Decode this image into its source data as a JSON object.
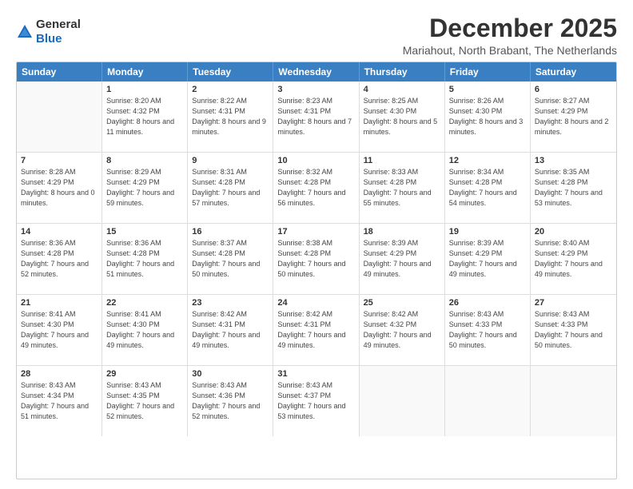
{
  "logo": {
    "general": "General",
    "blue": "Blue"
  },
  "header": {
    "month_year": "December 2025",
    "location": "Mariahout, North Brabant, The Netherlands"
  },
  "days_of_week": [
    "Sunday",
    "Monday",
    "Tuesday",
    "Wednesday",
    "Thursday",
    "Friday",
    "Saturday"
  ],
  "weeks": [
    [
      {
        "day": "",
        "empty": true
      },
      {
        "day": "1",
        "sunrise": "Sunrise: 8:20 AM",
        "sunset": "Sunset: 4:32 PM",
        "daylight": "Daylight: 8 hours and 11 minutes."
      },
      {
        "day": "2",
        "sunrise": "Sunrise: 8:22 AM",
        "sunset": "Sunset: 4:31 PM",
        "daylight": "Daylight: 8 hours and 9 minutes."
      },
      {
        "day": "3",
        "sunrise": "Sunrise: 8:23 AM",
        "sunset": "Sunset: 4:31 PM",
        "daylight": "Daylight: 8 hours and 7 minutes."
      },
      {
        "day": "4",
        "sunrise": "Sunrise: 8:25 AM",
        "sunset": "Sunset: 4:30 PM",
        "daylight": "Daylight: 8 hours and 5 minutes."
      },
      {
        "day": "5",
        "sunrise": "Sunrise: 8:26 AM",
        "sunset": "Sunset: 4:30 PM",
        "daylight": "Daylight: 8 hours and 3 minutes."
      },
      {
        "day": "6",
        "sunrise": "Sunrise: 8:27 AM",
        "sunset": "Sunset: 4:29 PM",
        "daylight": "Daylight: 8 hours and 2 minutes."
      }
    ],
    [
      {
        "day": "7",
        "sunrise": "Sunrise: 8:28 AM",
        "sunset": "Sunset: 4:29 PM",
        "daylight": "Daylight: 8 hours and 0 minutes."
      },
      {
        "day": "8",
        "sunrise": "Sunrise: 8:29 AM",
        "sunset": "Sunset: 4:29 PM",
        "daylight": "Daylight: 7 hours and 59 minutes."
      },
      {
        "day": "9",
        "sunrise": "Sunrise: 8:31 AM",
        "sunset": "Sunset: 4:28 PM",
        "daylight": "Daylight: 7 hours and 57 minutes."
      },
      {
        "day": "10",
        "sunrise": "Sunrise: 8:32 AM",
        "sunset": "Sunset: 4:28 PM",
        "daylight": "Daylight: 7 hours and 56 minutes."
      },
      {
        "day": "11",
        "sunrise": "Sunrise: 8:33 AM",
        "sunset": "Sunset: 4:28 PM",
        "daylight": "Daylight: 7 hours and 55 minutes."
      },
      {
        "day": "12",
        "sunrise": "Sunrise: 8:34 AM",
        "sunset": "Sunset: 4:28 PM",
        "daylight": "Daylight: 7 hours and 54 minutes."
      },
      {
        "day": "13",
        "sunrise": "Sunrise: 8:35 AM",
        "sunset": "Sunset: 4:28 PM",
        "daylight": "Daylight: 7 hours and 53 minutes."
      }
    ],
    [
      {
        "day": "14",
        "sunrise": "Sunrise: 8:36 AM",
        "sunset": "Sunset: 4:28 PM",
        "daylight": "Daylight: 7 hours and 52 minutes."
      },
      {
        "day": "15",
        "sunrise": "Sunrise: 8:36 AM",
        "sunset": "Sunset: 4:28 PM",
        "daylight": "Daylight: 7 hours and 51 minutes."
      },
      {
        "day": "16",
        "sunrise": "Sunrise: 8:37 AM",
        "sunset": "Sunset: 4:28 PM",
        "daylight": "Daylight: 7 hours and 50 minutes."
      },
      {
        "day": "17",
        "sunrise": "Sunrise: 8:38 AM",
        "sunset": "Sunset: 4:28 PM",
        "daylight": "Daylight: 7 hours and 50 minutes."
      },
      {
        "day": "18",
        "sunrise": "Sunrise: 8:39 AM",
        "sunset": "Sunset: 4:29 PM",
        "daylight": "Daylight: 7 hours and 49 minutes."
      },
      {
        "day": "19",
        "sunrise": "Sunrise: 8:39 AM",
        "sunset": "Sunset: 4:29 PM",
        "daylight": "Daylight: 7 hours and 49 minutes."
      },
      {
        "day": "20",
        "sunrise": "Sunrise: 8:40 AM",
        "sunset": "Sunset: 4:29 PM",
        "daylight": "Daylight: 7 hours and 49 minutes."
      }
    ],
    [
      {
        "day": "21",
        "sunrise": "Sunrise: 8:41 AM",
        "sunset": "Sunset: 4:30 PM",
        "daylight": "Daylight: 7 hours and 49 minutes."
      },
      {
        "day": "22",
        "sunrise": "Sunrise: 8:41 AM",
        "sunset": "Sunset: 4:30 PM",
        "daylight": "Daylight: 7 hours and 49 minutes."
      },
      {
        "day": "23",
        "sunrise": "Sunrise: 8:42 AM",
        "sunset": "Sunset: 4:31 PM",
        "daylight": "Daylight: 7 hours and 49 minutes."
      },
      {
        "day": "24",
        "sunrise": "Sunrise: 8:42 AM",
        "sunset": "Sunset: 4:31 PM",
        "daylight": "Daylight: 7 hours and 49 minutes."
      },
      {
        "day": "25",
        "sunrise": "Sunrise: 8:42 AM",
        "sunset": "Sunset: 4:32 PM",
        "daylight": "Daylight: 7 hours and 49 minutes."
      },
      {
        "day": "26",
        "sunrise": "Sunrise: 8:43 AM",
        "sunset": "Sunset: 4:33 PM",
        "daylight": "Daylight: 7 hours and 50 minutes."
      },
      {
        "day": "27",
        "sunrise": "Sunrise: 8:43 AM",
        "sunset": "Sunset: 4:33 PM",
        "daylight": "Daylight: 7 hours and 50 minutes."
      }
    ],
    [
      {
        "day": "28",
        "sunrise": "Sunrise: 8:43 AM",
        "sunset": "Sunset: 4:34 PM",
        "daylight": "Daylight: 7 hours and 51 minutes."
      },
      {
        "day": "29",
        "sunrise": "Sunrise: 8:43 AM",
        "sunset": "Sunset: 4:35 PM",
        "daylight": "Daylight: 7 hours and 52 minutes."
      },
      {
        "day": "30",
        "sunrise": "Sunrise: 8:43 AM",
        "sunset": "Sunset: 4:36 PM",
        "daylight": "Daylight: 7 hours and 52 minutes."
      },
      {
        "day": "31",
        "sunrise": "Sunrise: 8:43 AM",
        "sunset": "Sunset: 4:37 PM",
        "daylight": "Daylight: 7 hours and 53 minutes."
      },
      {
        "day": "",
        "empty": true
      },
      {
        "day": "",
        "empty": true
      },
      {
        "day": "",
        "empty": true
      }
    ]
  ]
}
